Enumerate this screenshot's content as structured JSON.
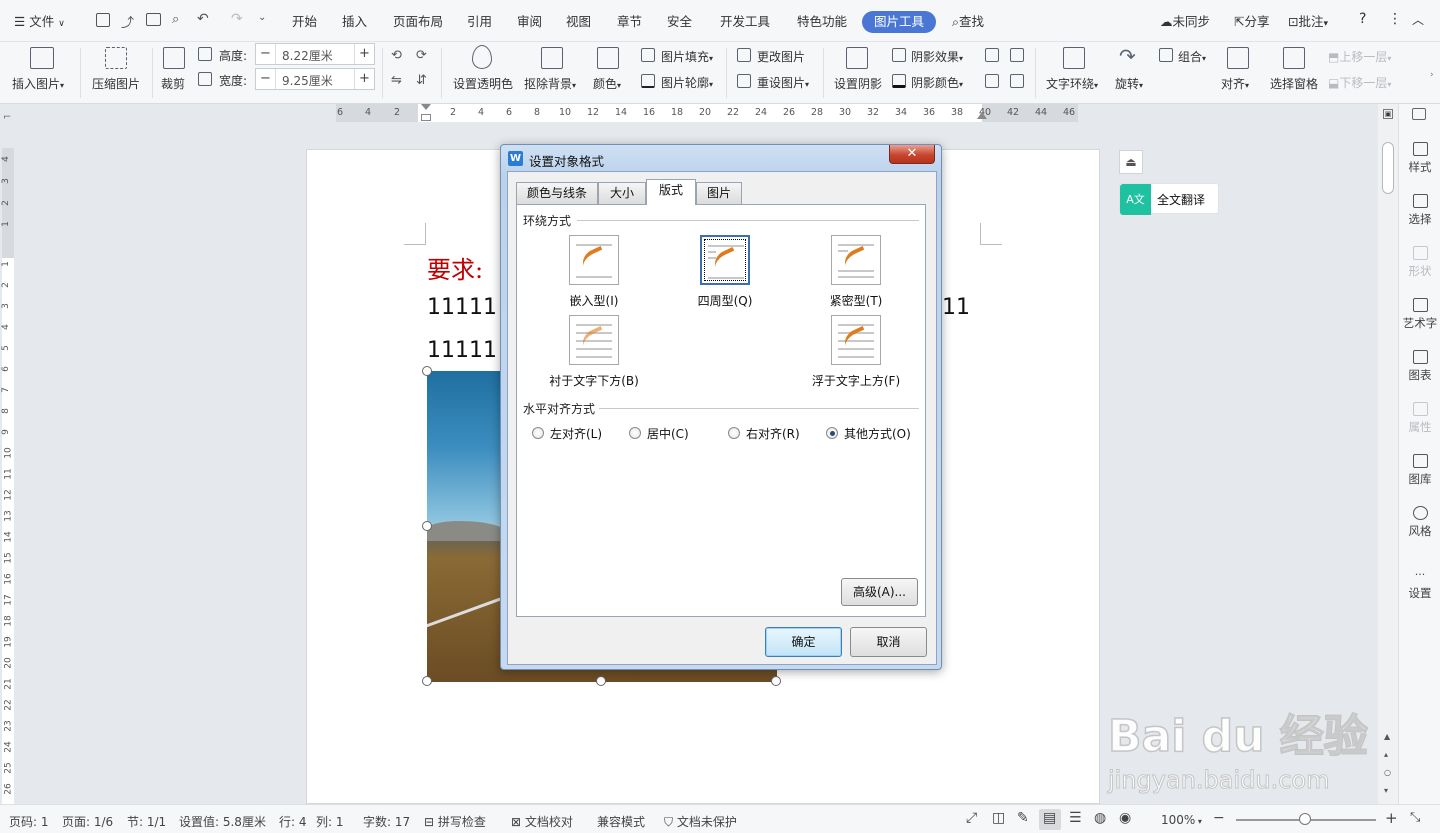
{
  "menubar": {
    "file": "文件",
    "tabs": [
      "开始",
      "插入",
      "页面布局",
      "引用",
      "审阅",
      "视图",
      "章节",
      "安全",
      "开发工具",
      "特色功能"
    ],
    "active_tab": "图片工具",
    "search": "查找",
    "sync": "未同步",
    "share": "分享",
    "comment": "批注",
    "help": "?",
    "more": "⋮",
    "collapse": "︿"
  },
  "ribbon": {
    "insert_picture": "插入图片",
    "compress": "压缩图片",
    "crop": "裁剪",
    "height_label": "高度:",
    "height_value": "8.22厘米",
    "width_label": "宽度:",
    "width_value": "9.25厘米",
    "transparency": "设置透明色",
    "remove_bg": "抠除背景",
    "color": "颜色",
    "fill": "图片填充",
    "outline": "图片轮廓",
    "change_picture": "更改图片",
    "reset_picture": "重设图片",
    "shadow": "设置阴影",
    "shadow_effect": "阴影效果",
    "shadow_color": "阴影颜色",
    "text_wrap": "文字环绕",
    "rotate": "旋转",
    "group": "组合",
    "align": "对齐",
    "selection_pane": "选择窗格",
    "bring_forward": "上移一层",
    "send_backward": "下移一层"
  },
  "ruler": {
    "h_ticks": [
      "6",
      "4",
      "2",
      "2",
      "4",
      "6",
      "8",
      "10",
      "12",
      "14",
      "16",
      "18",
      "20",
      "22",
      "24",
      "26",
      "28",
      "30",
      "32",
      "34",
      "36",
      "38",
      "40",
      "42",
      "44",
      "46"
    ],
    "v_ticks_top": [
      "4",
      "3",
      "2",
      "1"
    ],
    "v_ticks": [
      "1",
      "2",
      "3",
      "4",
      "5",
      "6",
      "7",
      "8",
      "9",
      "10",
      "11",
      "12",
      "13",
      "14",
      "15",
      "16",
      "17",
      "18",
      "19",
      "20",
      "21",
      "22",
      "23",
      "24",
      "25",
      "26"
    ]
  },
  "document": {
    "heading": "要求:",
    "line1_left": "11111",
    "line1_right": "11",
    "line2_left": "11111"
  },
  "floating": {
    "translate": "全文翻译"
  },
  "right_panel": [
    {
      "label": "样式",
      "enabled": true
    },
    {
      "label": "选择",
      "enabled": true
    },
    {
      "label": "形状",
      "enabled": false
    },
    {
      "label": "艺术字",
      "enabled": true
    },
    {
      "label": "图表",
      "enabled": true
    },
    {
      "label": "属性",
      "enabled": false
    },
    {
      "label": "图库",
      "enabled": true
    },
    {
      "label": "风格",
      "enabled": true
    },
    {
      "label": "设置",
      "enabled": true
    }
  ],
  "dialog": {
    "title": "设置对象格式",
    "close": "✕",
    "tabs": [
      "颜色与线条",
      "大小",
      "版式",
      "图片"
    ],
    "active_tab": "版式",
    "wrap_group": "环绕方式",
    "wrap_options": [
      "嵌入型(I)",
      "四周型(Q)",
      "紧密型(T)",
      "衬于文字下方(B)",
      "浮于文字上方(F)"
    ],
    "wrap_selected": "四周型(Q)",
    "halign_group": "水平对齐方式",
    "halign_options": [
      "左对齐(L)",
      "居中(C)",
      "右对齐(R)",
      "其他方式(O)"
    ],
    "halign_selected": "其他方式(O)",
    "advanced": "高级(A)...",
    "ok": "确定",
    "cancel": "取消"
  },
  "statusbar": {
    "page_no": "页码: 1",
    "pages": "页面: 1/6",
    "section": "节: 1/1",
    "setting": "设置值: 5.8厘米",
    "row": "行: 4",
    "col": "列: 1",
    "words": "字数: 17",
    "spell": "拼写检查",
    "proof": "文档校对",
    "compat": "兼容模式",
    "protect": "文档未保护",
    "zoom": "100%"
  },
  "watermark": {
    "brand": "Bai du 经验",
    "url": "jingyan.baidu.com"
  },
  "colors": {
    "accent": "#4a77d4",
    "heading_red": "#c00000",
    "translate_green": "#1fc2a0"
  }
}
